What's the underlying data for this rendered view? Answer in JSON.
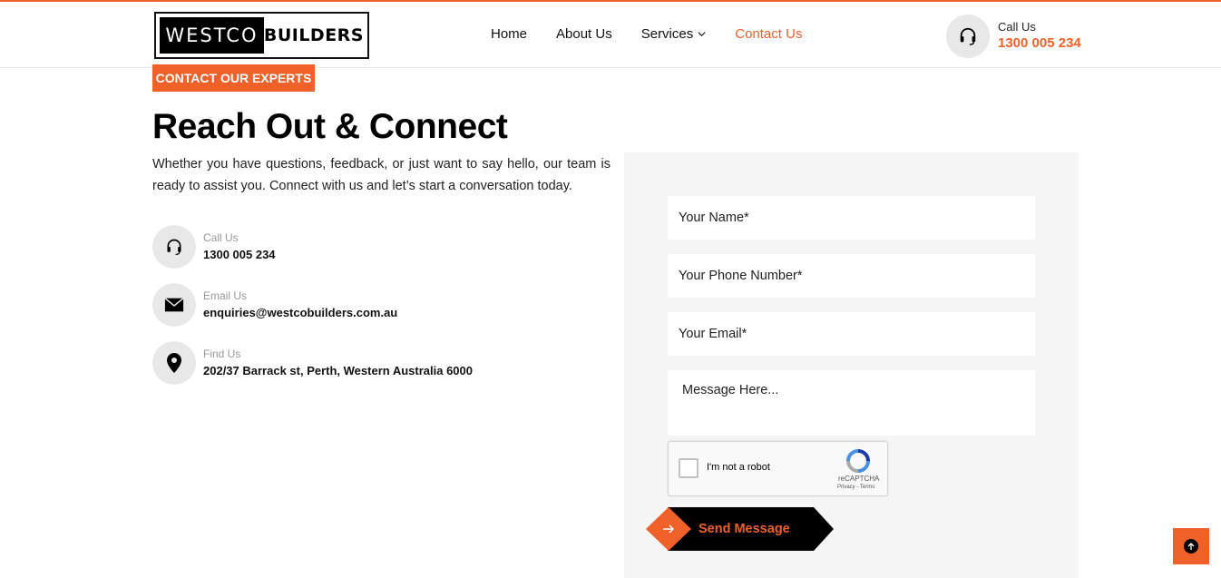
{
  "brand": {
    "logo_left": "WESTCO",
    "logo_right": "BUILDERS"
  },
  "nav": {
    "items": [
      {
        "label": "Home"
      },
      {
        "label": "About Us"
      },
      {
        "label": "Services"
      },
      {
        "label": "Contact Us"
      }
    ],
    "active": "Contact Us"
  },
  "header_call": {
    "label": "Call Us",
    "number": "1300 005 234",
    "icon": "headset-icon"
  },
  "section": {
    "badge": "CONTACT OUR EXPERTS",
    "title": "Reach Out & Connect",
    "intro": "Whether you have questions, feedback, or just want to say hello, our team is ready to assist you. Connect with us and let’s start a conversation today."
  },
  "contacts": [
    {
      "label": "Call Us",
      "value": "1300 005 234",
      "icon": "headset-icon"
    },
    {
      "label": "Email Us",
      "value": "enquiries@westcobuilders.com.au",
      "icon": "envelope-icon"
    },
    {
      "label": "Find Us",
      "value": "202/37 Barrack st, Perth, Western Australia 6000",
      "icon": "map-pin-icon"
    }
  ],
  "form": {
    "name_placeholder": "Your Name*",
    "phone_placeholder": "Your Phone Number*",
    "email_placeholder": "Your Email*",
    "message_placeholder": "Message Here...",
    "captcha_label": "I'm not a robot",
    "captcha_brand": "reCAPTCHA",
    "captcha_terms": "Privacy - Terms",
    "submit_label": "Send Message"
  },
  "colors": {
    "accent": "#f0612a",
    "dark": "#000000",
    "panel": "#f5f5f5"
  }
}
